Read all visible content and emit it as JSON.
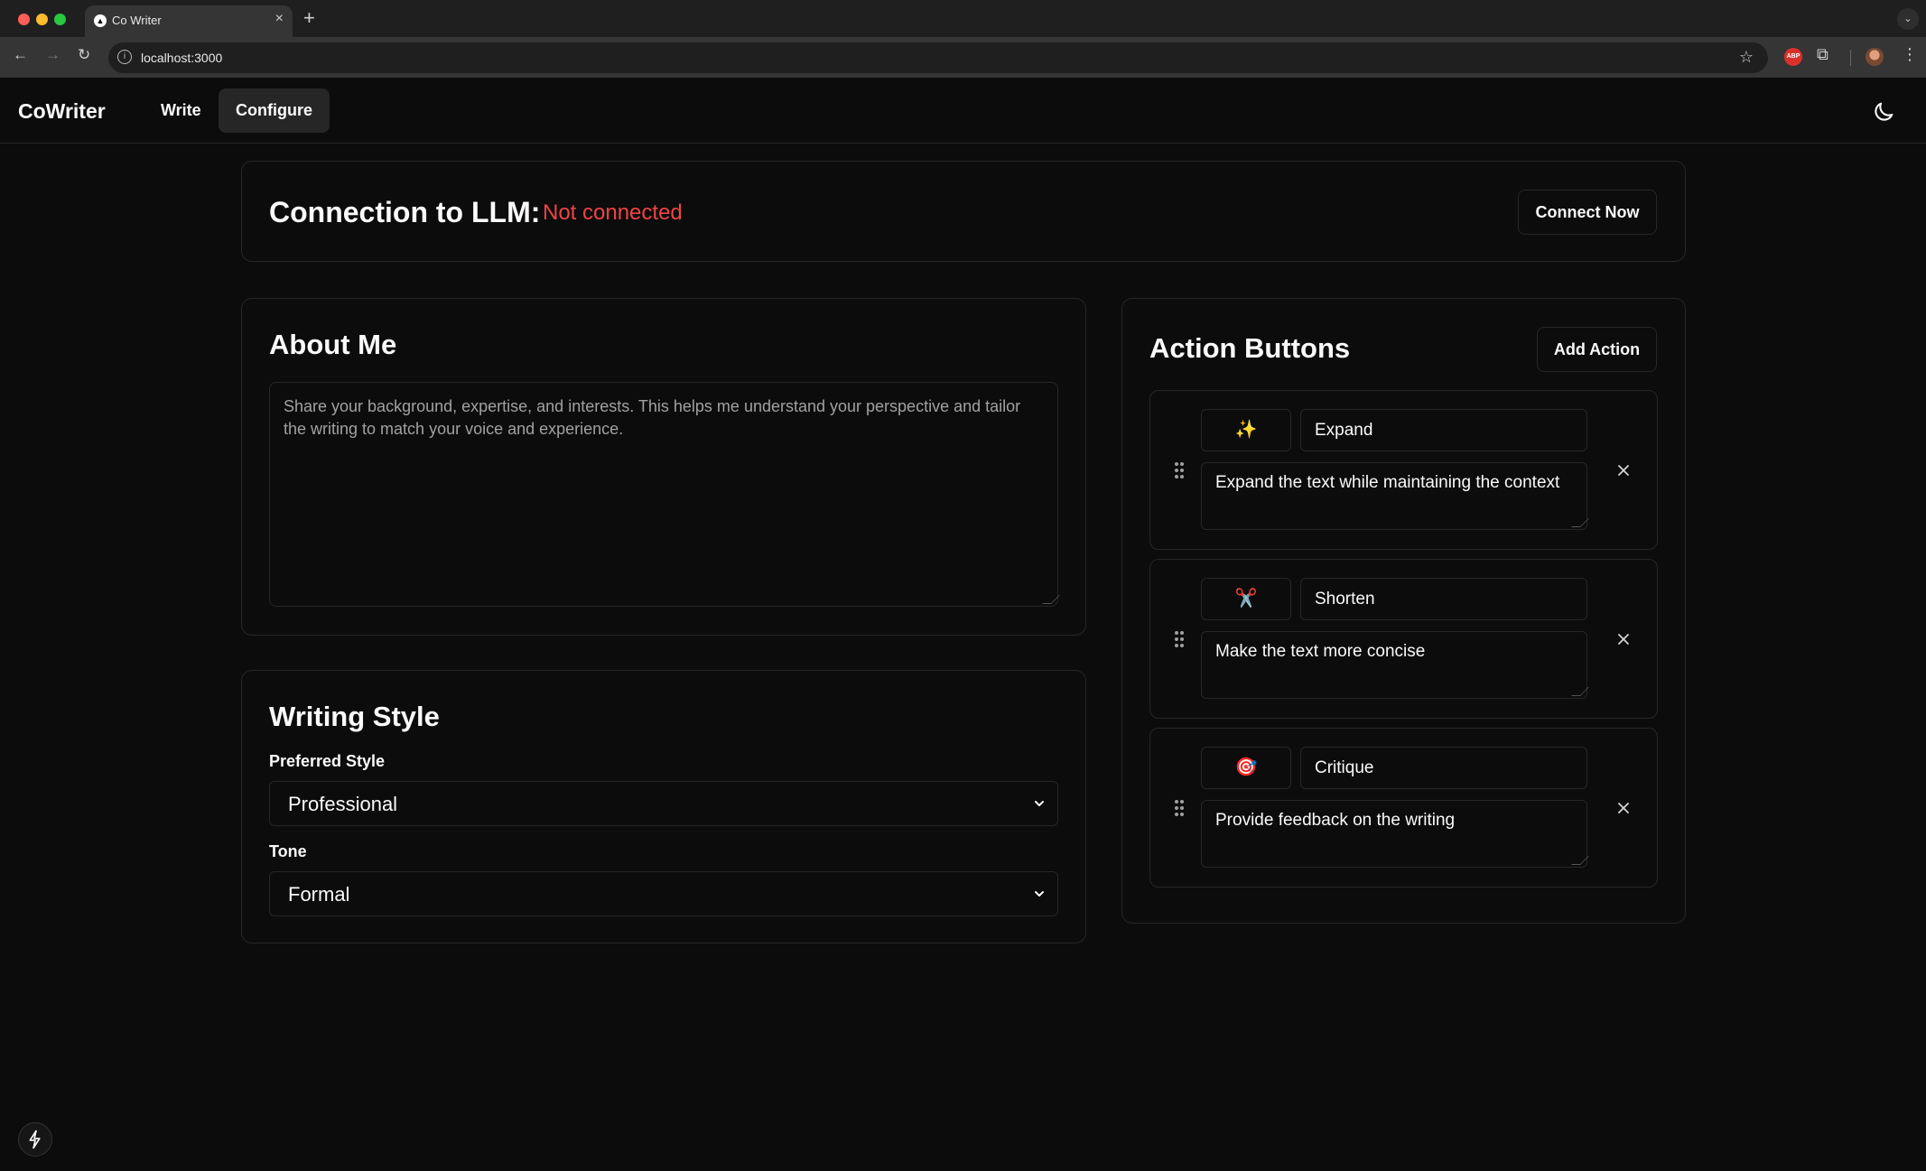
{
  "browser": {
    "tab_title": "Co Writer",
    "url": "localhost:3000",
    "ext_abp": "ABP"
  },
  "app": {
    "brand": "CoWriter",
    "nav": {
      "write": "Write",
      "configure": "Configure"
    }
  },
  "connection": {
    "label": "Connection to LLM:",
    "status": "Not connected",
    "status_color": "#ef4444",
    "button": "Connect Now"
  },
  "about": {
    "title": "About Me",
    "placeholder": "Share your background, expertise, and interests. This helps me understand your perspective and tailor the writing to match your voice and experience."
  },
  "writing_style": {
    "title": "Writing Style",
    "preferred_label": "Preferred Style",
    "preferred_value": "Professional",
    "tone_label": "Tone",
    "tone_value": "Formal"
  },
  "actions": {
    "title": "Action Buttons",
    "add_button": "Add Action",
    "items": [
      {
        "emoji": "✨",
        "name": "Expand",
        "prompt": "Expand the text while maintaining the context"
      },
      {
        "emoji": "✂️",
        "name": "Shorten",
        "prompt": "Make the text more concise"
      },
      {
        "emoji": "🎯",
        "name": "Critique",
        "prompt": "Provide feedback on the writing"
      }
    ]
  },
  "icons": {
    "theme": "moon-icon",
    "drag": "grip-vertical-icon",
    "remove": "close-icon",
    "status": "bolt-icon"
  }
}
